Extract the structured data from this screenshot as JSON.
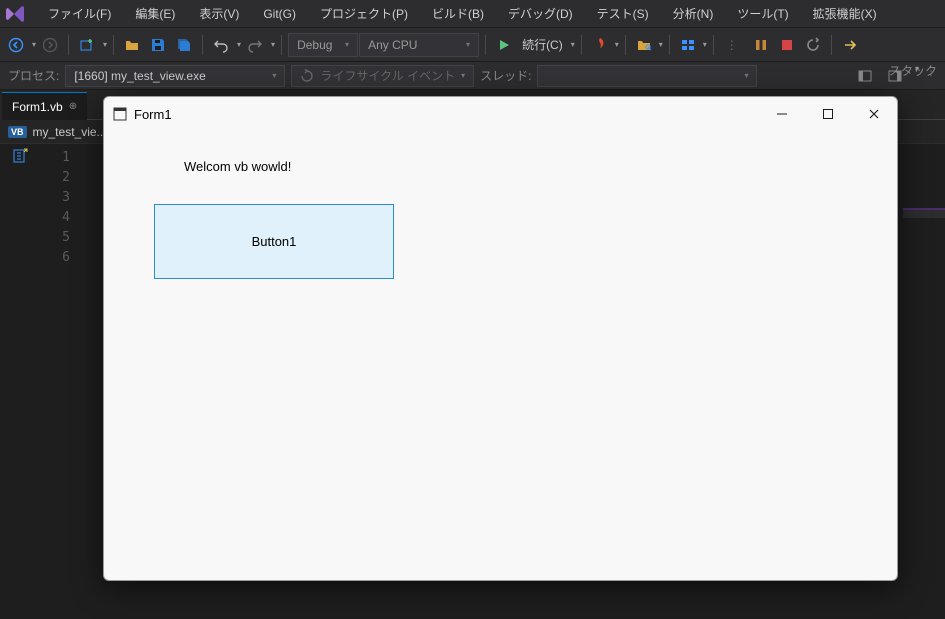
{
  "menu": {
    "items": [
      "ファイル(F)",
      "編集(E)",
      "表示(V)",
      "Git(G)",
      "プロジェクト(P)",
      "ビルド(B)",
      "デバッグ(D)",
      "テスト(S)",
      "分析(N)",
      "ツール(T)",
      "拡張機能(X)"
    ]
  },
  "toolbar": {
    "config": "Debug",
    "platform": "Any CPU",
    "continue_label": "続行(C)"
  },
  "process_bar": {
    "label": "プロセス:",
    "process": "[1660] my_test_view.exe",
    "lifecycle": "ライフサイクル イベント",
    "thread_label": "スレッド:",
    "stack": "スタック"
  },
  "tabs": {
    "active": "Form1.vb"
  },
  "context": {
    "file": "my_test_vie..."
  },
  "editor": {
    "lines": [
      "1",
      "2",
      "3",
      "4",
      "5",
      "6"
    ]
  },
  "app": {
    "title": "Form1",
    "label_text": "Welcom vb wowld!",
    "button_text": "Button1"
  },
  "colors": {
    "accent_blue": "#007acc",
    "button_fill": "#e0f1fb",
    "button_border": "#2a8dd4"
  }
}
